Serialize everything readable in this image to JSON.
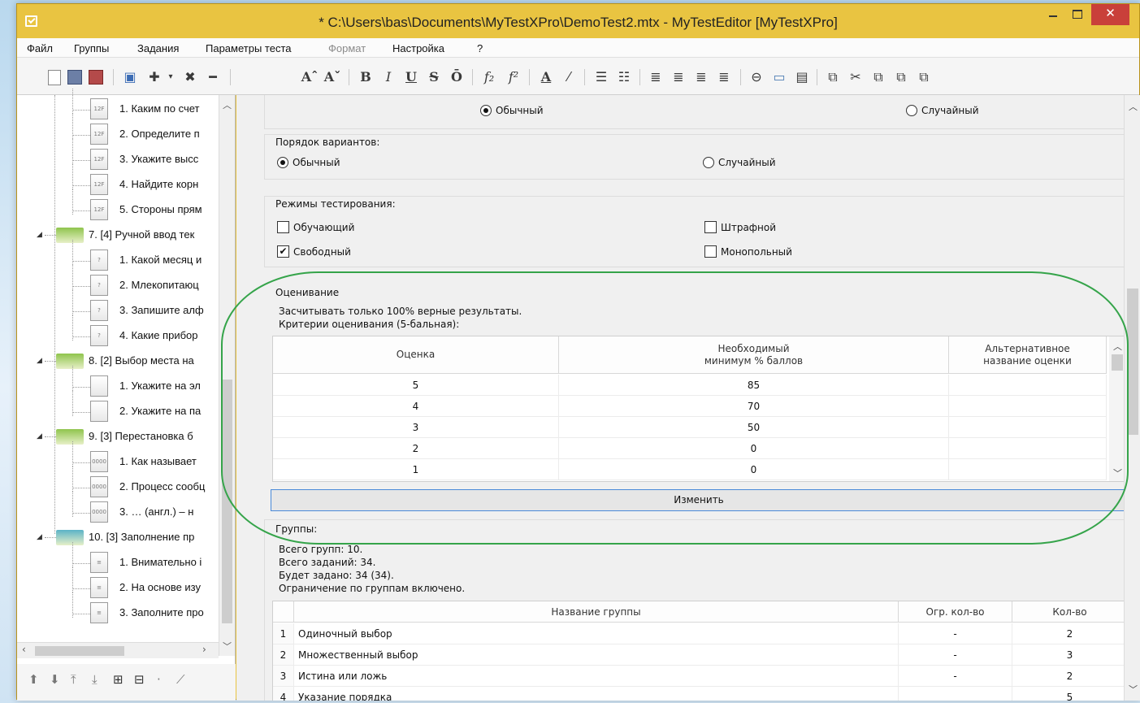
{
  "window": {
    "title": "* C:\\Users\\bas\\Documents\\MyTestXPro\\DemoTest2.mtx - MyTestEditor [MyTestXPro]",
    "close_label": "✕"
  },
  "menu": {
    "file": "Файл",
    "groups": "Группы",
    "tasks": "Задания",
    "test_params": "Параметры теста",
    "format": "Формат",
    "settings": "Настройка",
    "help": "?"
  },
  "toolbar": {
    "font_grow": "Aˆ",
    "font_shrink": "Aˇ",
    "bold": "B",
    "italic": "I",
    "underline": "U",
    "strike": "S",
    "overline": "Ō",
    "subscript": "f₂",
    "superscript": "f²",
    "font_color": "A",
    "highlight": "⁄"
  },
  "tree": {
    "items": [
      {
        "label": "1. Каким по счет",
        "kind": "doc",
        "icon_text": "12F"
      },
      {
        "label": "2. Определите п",
        "kind": "doc",
        "icon_text": "12F"
      },
      {
        "label": "3. Укажите высс",
        "kind": "doc",
        "icon_text": "12F"
      },
      {
        "label": "4. Найдите корн",
        "kind": "doc",
        "icon_text": "12F"
      },
      {
        "label": "5. Стороны прям",
        "kind": "doc",
        "icon_text": "12F"
      },
      {
        "label": "7. [4] Ручной ввод тек",
        "kind": "folder"
      },
      {
        "label": "1. Какой месяц и",
        "kind": "doc",
        "icon_text": "?"
      },
      {
        "label": "2. Млекопитаюц",
        "kind": "doc",
        "icon_text": "?"
      },
      {
        "label": "3. Запишите алф",
        "kind": "doc",
        "icon_text": "?"
      },
      {
        "label": "4. Какие прибор",
        "kind": "doc",
        "icon_text": "?"
      },
      {
        "label": "8. [2] Выбор места на",
        "kind": "folder"
      },
      {
        "label": "1. Укажите на эл",
        "kind": "doc",
        "icon_text": ""
      },
      {
        "label": "2. Укажите на па",
        "kind": "doc",
        "icon_text": ""
      },
      {
        "label": "9. [3] Перестановка б",
        "kind": "folder"
      },
      {
        "label": "1. Как называет",
        "kind": "doc",
        "icon_text": "0000"
      },
      {
        "label": "2. Процесс сообц",
        "kind": "doc",
        "icon_text": "0000"
      },
      {
        "label": "3. … (англ.) – н",
        "kind": "doc",
        "icon_text": "0000"
      },
      {
        "label": "10. [3] Заполнение пр",
        "kind": "folder"
      },
      {
        "label": "1. Внимательно і",
        "kind": "doc",
        "icon_text": "≡"
      },
      {
        "label": "2. На основе изу",
        "kind": "doc",
        "icon_text": "≡"
      },
      {
        "label": "3. Заполните про",
        "kind": "doc",
        "icon_text": "≡"
      }
    ]
  },
  "questions_order": {
    "normal": "Обычный",
    "random": "Случайный"
  },
  "variants_order": {
    "title": "Порядок вариантов:",
    "normal": "Обычный",
    "random": "Случайный"
  },
  "modes": {
    "title": "Режимы тестирования:",
    "training": "Обучающий",
    "penalty": "Штрафной",
    "free": "Свободный",
    "monopoly": "Монопольный",
    "free_check": "✔"
  },
  "grading": {
    "title": "Оценивание",
    "note1": "Засчитывать только 100% верные результаты.",
    "note2": "Критерии оценивания (5-бальная):",
    "col_grade": "Оценка",
    "col_min_l1": "Необходимый",
    "col_min_l2": "минимум % баллов",
    "col_alt_l1": "Альтернативное",
    "col_alt_l2": "название оценки",
    "rows": [
      {
        "grade": "5",
        "min": "85",
        "alt": ""
      },
      {
        "grade": "4",
        "min": "70",
        "alt": ""
      },
      {
        "grade": "3",
        "min": "50",
        "alt": ""
      },
      {
        "grade": "2",
        "min": "0",
        "alt": ""
      },
      {
        "grade": "1",
        "min": "0",
        "alt": ""
      }
    ],
    "change_button": "Изменить"
  },
  "groups": {
    "title": "Группы:",
    "total_groups": "Всего групп: 10.",
    "total_tasks": "Всего заданий: 34.",
    "will_be_asked": "Будет задано: 34 (34).",
    "limit": "Ограничение по группам включено.",
    "col_name": "Название группы",
    "col_limit": "Огр. кол-во",
    "col_count": "Кол-во",
    "rows": [
      {
        "n": "1",
        "name": "Одиночный выбор",
        "limit": "-",
        "count": "2"
      },
      {
        "n": "2",
        "name": "Множественный выбор",
        "limit": "-",
        "count": "3"
      },
      {
        "n": "3",
        "name": "Истина или ложь",
        "limit": "-",
        "count": "2"
      },
      {
        "n": "4",
        "name": "Указание порядка",
        "limit": "",
        "count": "5"
      }
    ]
  },
  "colors": {
    "title_bar": "#e9c441",
    "close_button": "#c9403a",
    "annotation": "#35a44a",
    "folder_green": "#8fc44d",
    "folder_teal": "#5bb3c7"
  }
}
